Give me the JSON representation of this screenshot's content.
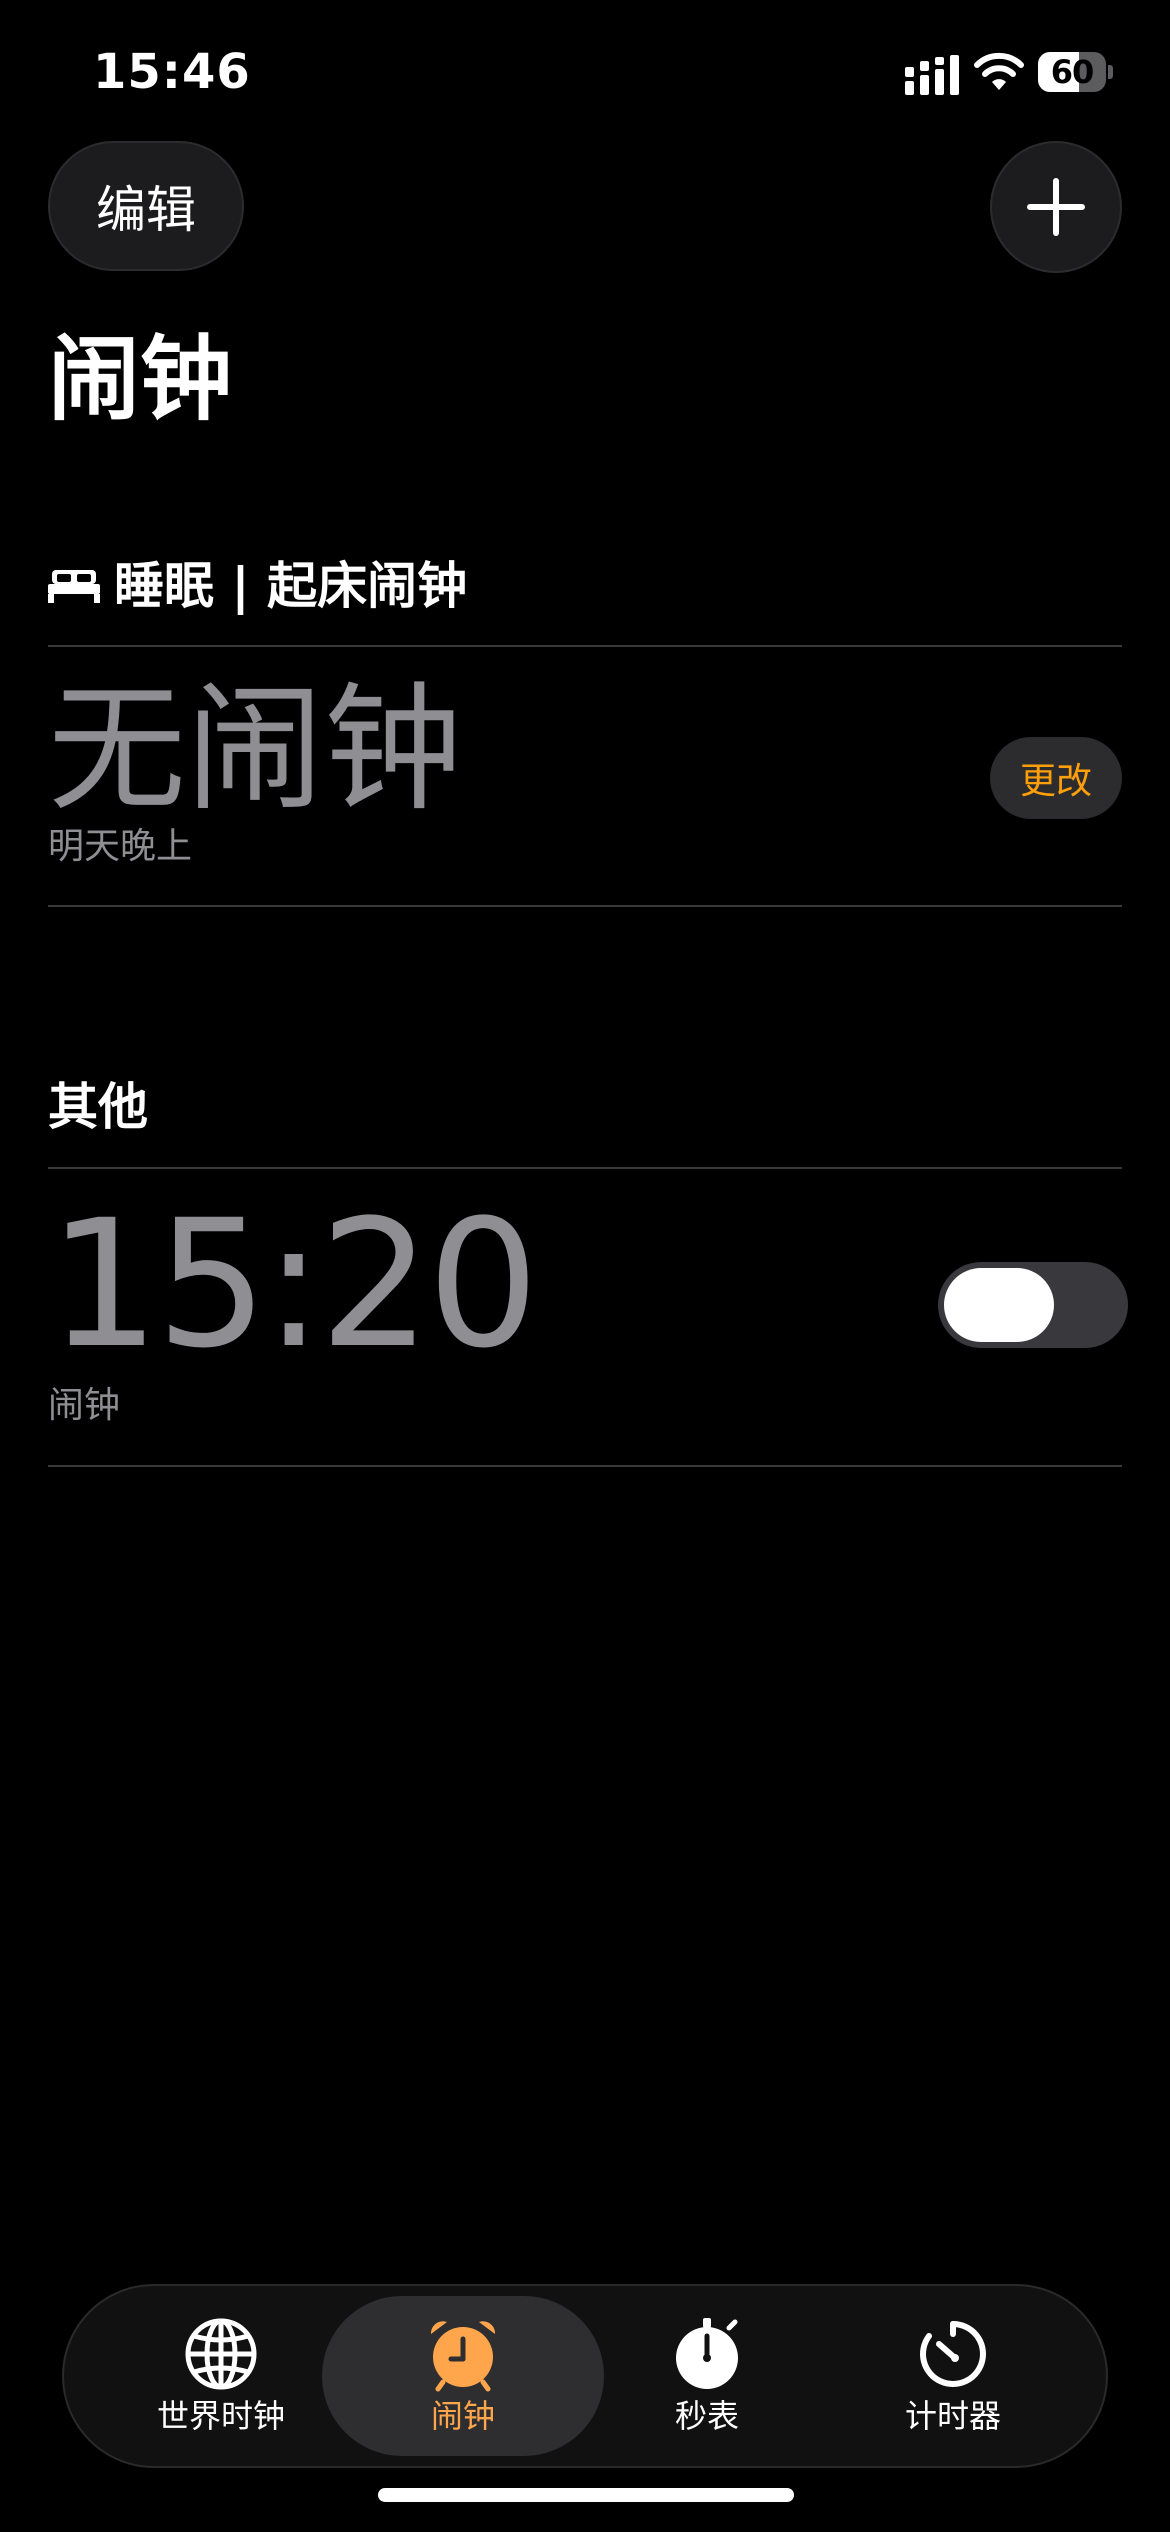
{
  "status_bar": {
    "time": "15:46",
    "battery_percent": "60",
    "battery_level": 0.6
  },
  "header": {
    "edit_label": "编辑",
    "title": "闹钟"
  },
  "sleep_section": {
    "header_label": "睡眠 | 起床闹钟",
    "main_text": "无闹钟",
    "sub_text": "明天晚上",
    "change_label": "更改"
  },
  "other_section": {
    "header_label": "其他",
    "alarms": [
      {
        "time": "15:20",
        "label": "闹钟",
        "enabled": false
      }
    ]
  },
  "tab_bar": {
    "tabs": [
      {
        "label": "世界时钟",
        "icon": "globe-icon"
      },
      {
        "label": "闹钟",
        "icon": "alarm-clock-icon",
        "active": true
      },
      {
        "label": "秒表",
        "icon": "stopwatch-icon"
      },
      {
        "label": "计时器",
        "icon": "timer-icon"
      }
    ]
  },
  "colors": {
    "accent": "#ff9f0a",
    "tab_active": "#ffa64d",
    "secondary_text": "#8e8e93"
  }
}
